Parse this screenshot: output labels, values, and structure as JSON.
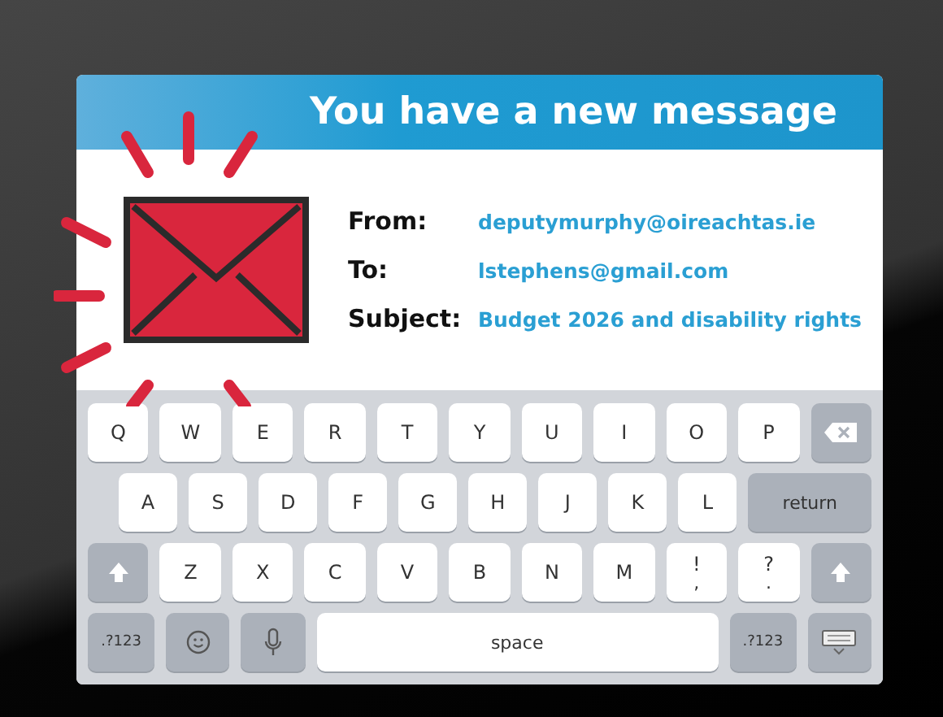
{
  "header": {
    "title": "You have a new message"
  },
  "fields": [
    {
      "label": "From:",
      "value": "deputymurphy@oireachtas.ie"
    },
    {
      "label": "To:",
      "value": "lstephens@gmail.com"
    },
    {
      "label": "Subject:",
      "value": "Budget 2026 and disability rights"
    }
  ],
  "keyboard": {
    "rows": [
      {
        "keys": [
          {
            "kind": "letter",
            "label": "Q"
          },
          {
            "kind": "letter",
            "label": "W"
          },
          {
            "kind": "letter",
            "label": "E"
          },
          {
            "kind": "letter",
            "label": "R"
          },
          {
            "kind": "letter",
            "label": "T"
          },
          {
            "kind": "letter",
            "label": "Y"
          },
          {
            "kind": "letter",
            "label": "U"
          },
          {
            "kind": "letter",
            "label": "I"
          },
          {
            "kind": "letter",
            "label": "O"
          },
          {
            "kind": "letter",
            "label": "P"
          },
          {
            "kind": "backspace"
          }
        ]
      },
      {
        "keys": [
          {
            "kind": "letter",
            "label": "A"
          },
          {
            "kind": "letter",
            "label": "S"
          },
          {
            "kind": "letter",
            "label": "D"
          },
          {
            "kind": "letter",
            "label": "F"
          },
          {
            "kind": "letter",
            "label": "G"
          },
          {
            "kind": "letter",
            "label": "H"
          },
          {
            "kind": "letter",
            "label": "J"
          },
          {
            "kind": "letter",
            "label": "K"
          },
          {
            "kind": "letter",
            "label": "L"
          },
          {
            "kind": "return",
            "label": "return"
          }
        ]
      },
      {
        "keys": [
          {
            "kind": "shift"
          },
          {
            "kind": "letter",
            "label": "Z"
          },
          {
            "kind": "letter",
            "label": "X"
          },
          {
            "kind": "letter",
            "label": "C"
          },
          {
            "kind": "letter",
            "label": "V"
          },
          {
            "kind": "letter",
            "label": "B"
          },
          {
            "kind": "letter",
            "label": "N"
          },
          {
            "kind": "letter",
            "label": "M"
          },
          {
            "kind": "punct",
            "label": "!",
            "sub": ","
          },
          {
            "kind": "punct",
            "label": "?",
            "sub": "."
          },
          {
            "kind": "shift"
          }
        ]
      },
      {
        "keys": [
          {
            "kind": "symbols",
            "label": ".?123"
          },
          {
            "kind": "emoji"
          },
          {
            "kind": "mic"
          },
          {
            "kind": "space",
            "label": "space"
          },
          {
            "kind": "symbols",
            "label": ".?123"
          },
          {
            "kind": "hide"
          }
        ]
      }
    ]
  }
}
